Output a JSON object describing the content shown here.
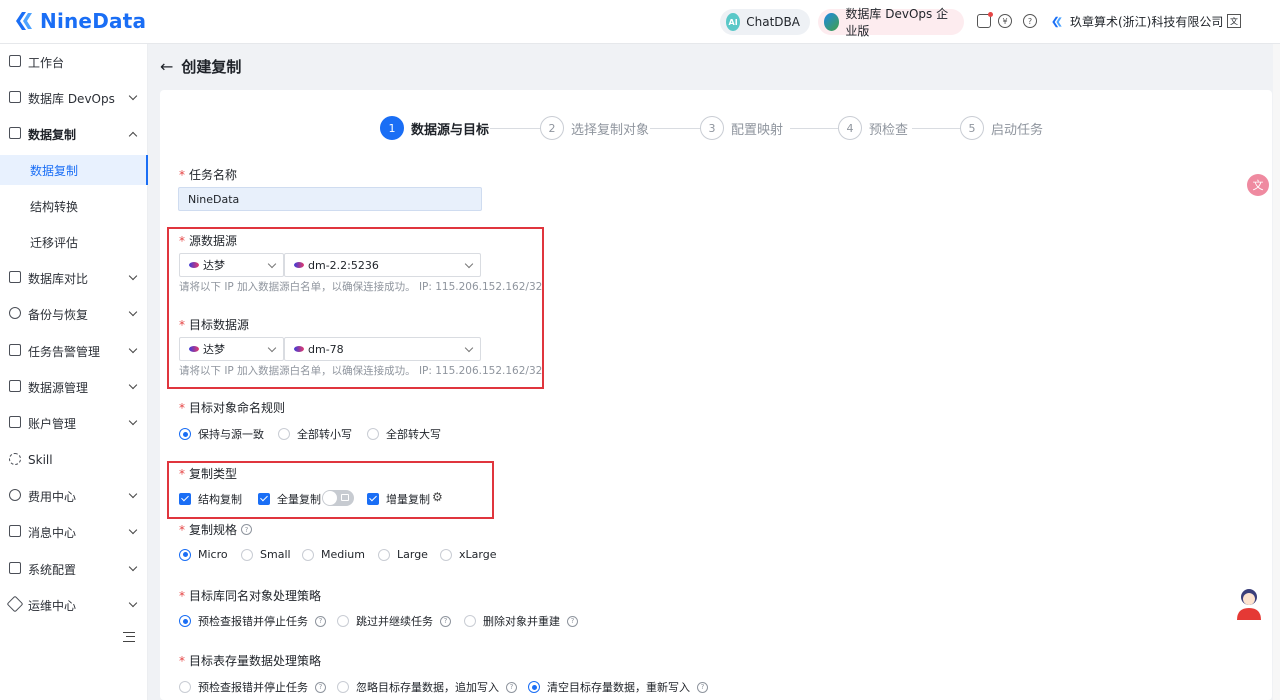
{
  "brand": {
    "name": "NineData"
  },
  "header": {
    "chatdba_label": "ChatDBA",
    "chatdba_icon_text": "AI",
    "edition_label": "数据库 DevOps 企业版",
    "icons": [
      "bell-icon",
      "yuan-icon",
      "help-icon"
    ],
    "org_name": "玖章算术(浙江)科技有限公司",
    "lang_icon_text": "文"
  },
  "sidebar": {
    "items": [
      {
        "label": "工作台",
        "icon": "home-icon"
      },
      {
        "label": "数据库 DevOps",
        "icon": "devops-icon"
      },
      {
        "label": "数据复制",
        "icon": "replication-icon"
      },
      {
        "label": "数据复制"
      },
      {
        "label": "结构转换"
      },
      {
        "label": "迁移评估"
      },
      {
        "label": "数据库对比",
        "icon": "compare-icon"
      },
      {
        "label": "备份与恢复",
        "icon": "backup-icon"
      },
      {
        "label": "任务告警管理",
        "icon": "alarm-icon"
      },
      {
        "label": "数据源管理",
        "icon": "datasource-icon"
      },
      {
        "label": "账户管理",
        "icon": "account-icon"
      },
      {
        "label": "Skill",
        "icon": "skill-icon"
      },
      {
        "label": "费用中心",
        "icon": "billing-icon"
      },
      {
        "label": "消息中心",
        "icon": "message-icon"
      },
      {
        "label": "系统配置",
        "icon": "config-icon"
      },
      {
        "label": "运维中心",
        "icon": "ops-icon"
      }
    ]
  },
  "page": {
    "back_icon": "←",
    "title": "创建复制"
  },
  "steps": [
    {
      "num": "1",
      "label": "数据源与目标",
      "active": true
    },
    {
      "num": "2",
      "label": "选择复制对象"
    },
    {
      "num": "3",
      "label": "配置映射"
    },
    {
      "num": "4",
      "label": "预检查"
    },
    {
      "num": "5",
      "label": "启动任务"
    }
  ],
  "form": {
    "required_mark": "*",
    "task_name": {
      "label": "任务名称",
      "value": "NineData"
    },
    "source": {
      "label": "源数据源",
      "db_type": "达梦",
      "instance": "dm-2.2:5236",
      "hint": "请将以下 IP 加入数据源白名单，以确保连接成功。 IP: 115.206.152.162/32"
    },
    "target": {
      "label": "目标数据源",
      "db_type": "达梦",
      "instance": "dm-78",
      "hint": "请将以下 IP 加入数据源白名单，以确保连接成功。 IP: 115.206.152.162/32"
    },
    "naming": {
      "label": "目标对象命名规则",
      "options": [
        "保持与源一致",
        "全部转小写",
        "全部转大写"
      ],
      "selected": "保持与源一致"
    },
    "copy_type": {
      "label": "复制类型",
      "options": [
        "结构复制",
        "全量复制",
        "增量复制"
      ]
    },
    "spec": {
      "label": "复制规格",
      "options": [
        "Micro",
        "Small",
        "Medium",
        "Large",
        "xLarge"
      ],
      "selected": "Micro"
    },
    "same_name": {
      "label": "目标库同名对象处理策略",
      "options": [
        "预检查报错并停止任务",
        "跳过并继续任务",
        "删除对象并重建"
      ],
      "selected": "预检查报错并停止任务"
    },
    "existing": {
      "label": "目标表存量数据处理策略",
      "options": [
        "预检查报错并停止任务",
        "忽略目标存量数据，追加写入",
        "清空目标存量数据，重新写入"
      ],
      "selected": "清空目标存量数据，重新写入"
    }
  }
}
